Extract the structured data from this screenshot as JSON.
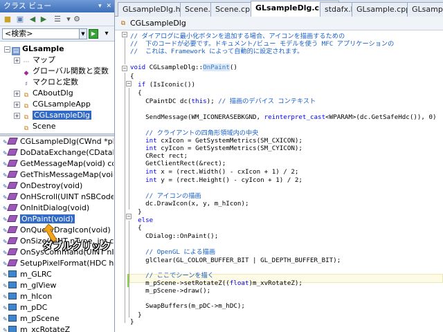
{
  "left_panel": {
    "title": "クラス ビュー",
    "search_placeholder": "<検索>",
    "tree": [
      {
        "label": "GLsample",
        "bold": true
      },
      {
        "label": "マップ"
      },
      {
        "label": "グローバル関数と変数"
      },
      {
        "label": "マクロと定数"
      },
      {
        "label": "CAboutDlg"
      },
      {
        "label": "CGLsampleApp"
      },
      {
        "label": "CGLsampleDlg",
        "selected": true
      },
      {
        "label": "Scene"
      }
    ],
    "members": [
      "CGLsampleDlg(CWnd *pParent",
      "DoDataExchange(CDataExch",
      "GetMessageMap(void) const",
      "GetThisMessageMap(void)",
      "OnDestroy(void)",
      "OnHScroll(UINT nSBCode, U",
      "OnInitDialog(void)",
      "OnPaint(void)",
      "OnQueryDragIcon(void)",
      "OnSize(UINT nType, int cx,",
      "OnSysCommand(UINT nID, L",
      "SetupPixelFormat(HDC hdc)",
      "m_GLRC",
      "m_glView",
      "m_hIcon",
      "m_pDC",
      "m_pScene",
      "m_xcRotateZ"
    ],
    "selected_member_index": 7,
    "callout_text": "ダブルクリック"
  },
  "editor": {
    "tabs": [
      "GLsampleDlg.h",
      "Scene.h",
      "Scene.cpp",
      "GLsampleDlg.cpp*",
      "stdafx.h",
      "GLsample.cpp",
      "GLsampl"
    ],
    "active_tab_index": 3,
    "scope": "CGLsampleDlg",
    "code_lines": [
      "// ダイアログに最小化ボタンを追加する場合、アイコンを描画するための",
      "//  下のコードが必要です。ドキュメント/ビュー モデルを使う MFC アプリケーションの",
      "//  これは、Framework によって自動的に設定されます。",
      "",
      "void CGLsampleDlg::OnPaint()",
      "{",
      "  if (IsIconic())",
      "  {",
      "    CPaintDC dc(this); // 描画のデバイス コンテキスト",
      "",
      "    SendMessage(WM_ICONERASEBKGND, reinterpret_cast<WPARAM>(dc.GetSafeHdc()), 0)",
      "",
      "    // クライアントの四角形領域内の中央",
      "    int cxIcon = GetSystemMetrics(SM_CXICON);",
      "    int cyIcon = GetSystemMetrics(SM_CYICON);",
      "    CRect rect;",
      "    GetClientRect(&rect);",
      "    int x = (rect.Width() - cxIcon + 1) / 2;",
      "    int y = (rect.Height() - cyIcon + 1) / 2;",
      "",
      "    // アイコンの描画",
      "    dc.DrawIcon(x, y, m_hIcon);",
      "  }",
      "  else",
      "  {",
      "    CDialog::OnPaint();",
      "",
      "    // OpenGL による描画",
      "    glClear(GL_COLOR_BUFFER_BIT | GL_DEPTH_BUFFER_BIT);",
      "",
      "    // ここでシーンを描く",
      "    m_pScene->setRotateZ((float)m_xvRotateZ);",
      "    m_pScene->draw();",
      "",
      "    SwapBuffers(m_pDC->m_hDC);",
      "  }",
      "}"
    ]
  },
  "colors": {
    "comment": "#1a5fc8",
    "keyword": "#0000ff",
    "selection": "#3169c6",
    "change_bar": "#8ed04a"
  }
}
